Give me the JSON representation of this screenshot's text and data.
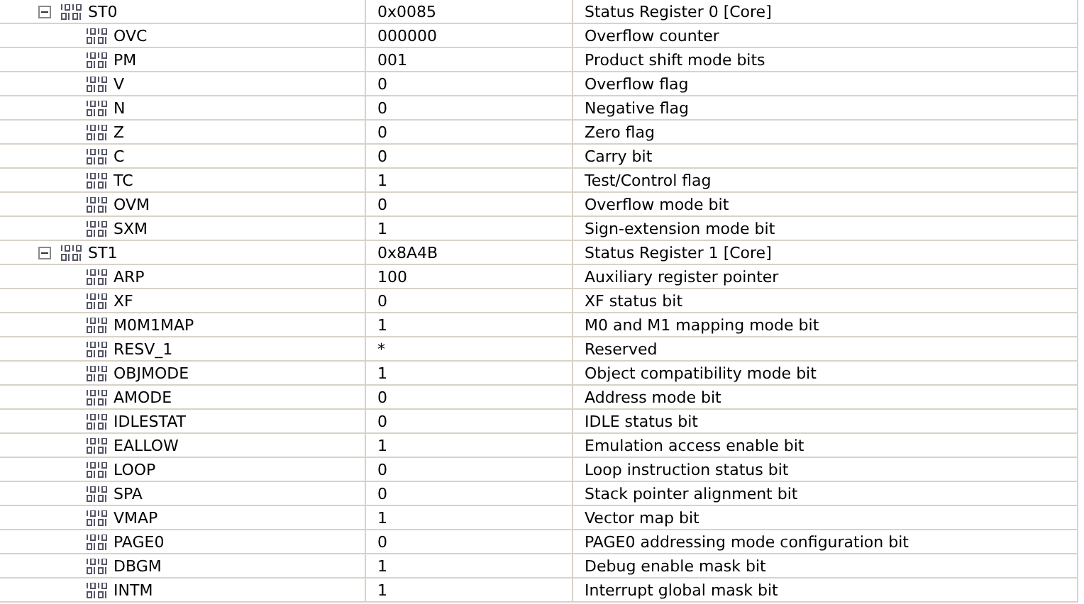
{
  "registers": [
    {
      "name": "ST0",
      "value": "0x0085",
      "description": "Status Register 0 [Core]",
      "expanded": true,
      "children": [
        {
          "name": "OVC",
          "value": "000000",
          "description": "Overflow counter"
        },
        {
          "name": "PM",
          "value": "001",
          "description": "Product shift mode bits"
        },
        {
          "name": "V",
          "value": "0",
          "description": "Overflow flag"
        },
        {
          "name": "N",
          "value": "0",
          "description": "Negative flag"
        },
        {
          "name": "Z",
          "value": "0",
          "description": "Zero flag"
        },
        {
          "name": "C",
          "value": "0",
          "description": "Carry bit"
        },
        {
          "name": "TC",
          "value": "1",
          "description": "Test/Control flag"
        },
        {
          "name": "OVM",
          "value": "0",
          "description": "Overflow mode bit"
        },
        {
          "name": "SXM",
          "value": "1",
          "description": "Sign-extension mode bit"
        }
      ]
    },
    {
      "name": "ST1",
      "value": "0x8A4B",
      "description": "Status Register 1 [Core]",
      "expanded": true,
      "children": [
        {
          "name": "ARP",
          "value": "100",
          "description": "Auxiliary register pointer"
        },
        {
          "name": "XF",
          "value": "0",
          "description": "XF status bit"
        },
        {
          "name": "M0M1MAP",
          "value": "1",
          "description": "M0 and M1 mapping mode bit"
        },
        {
          "name": "RESV_1",
          "value": "*",
          "description": "Reserved"
        },
        {
          "name": "OBJMODE",
          "value": "1",
          "description": "Object compatibility mode bit"
        },
        {
          "name": "AMODE",
          "value": "0",
          "description": "Address mode bit"
        },
        {
          "name": "IDLESTAT",
          "value": "0",
          "description": "IDLE status bit"
        },
        {
          "name": "EALLOW",
          "value": "1",
          "description": "Emulation access enable bit"
        },
        {
          "name": "LOOP",
          "value": "0",
          "description": "Loop instruction status bit"
        },
        {
          "name": "SPA",
          "value": "0",
          "description": "Stack pointer alignment bit"
        },
        {
          "name": "VMAP",
          "value": "1",
          "description": "Vector map bit"
        },
        {
          "name": "PAGE0",
          "value": "0",
          "description": "PAGE0 addressing mode configuration bit"
        },
        {
          "name": "DBGM",
          "value": "1",
          "description": "Debug enable mask bit"
        },
        {
          "name": "INTM",
          "value": "1",
          "description": "Interrupt global mask bit"
        }
      ]
    }
  ]
}
